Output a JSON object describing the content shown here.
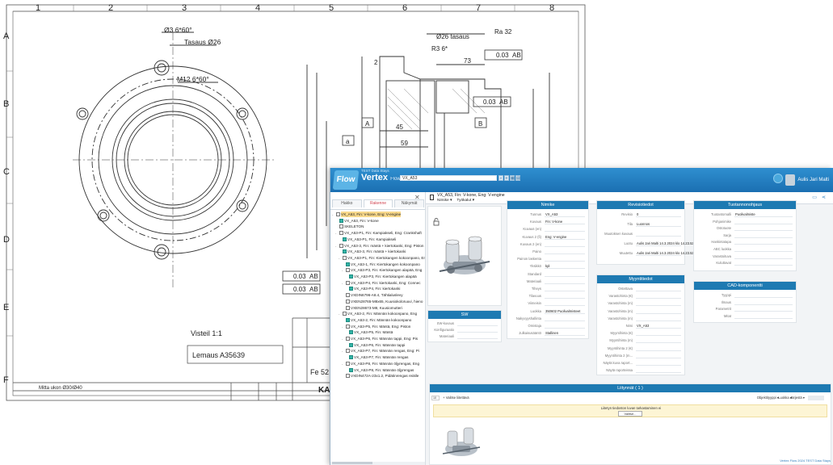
{
  "cad": {
    "columns": [
      "1",
      "2",
      "3",
      "4",
      "5",
      "6",
      "7",
      "8"
    ],
    "rows": [
      "A",
      "B",
      "C",
      "D",
      "E",
      "F"
    ],
    "notes": {
      "hole_spec": "Ø3 6*60°",
      "tasaus": "Tasaus Ø26",
      "thread": "M12 6*60°",
      "dim_tasaus2": "Ø26 tasaus",
      "dim_r3": "R3 6*",
      "dim_73": "73",
      "dim_45": "45",
      "dim_59": "59",
      "dim_2": "2",
      "tol_1": "0.03",
      "tol_a": "AB",
      "tol_2": "0.03",
      "tol_b": "AB",
      "tol_3": "0.03",
      "tol_c": "AB",
      "tol_4": "0.03",
      "tol_d": "AB",
      "roughness": "Ra 32",
      "label_a": "A",
      "label_b": "B",
      "label_a2": "a",
      "visteil": "Visteil 1:1",
      "lemaus": "Lemaus A35639",
      "material": "Fe 52",
      "mitta": "Mitta ukon Ø30/Ø40",
      "ka": "KA"
    }
  },
  "window": {
    "brand_top": "TEST Data Stays",
    "brand": "Vertex",
    "brand_small": "Flow 2024",
    "search_value": "VX_A53",
    "user_name": "Aulis Jari Malti",
    "status_text": "Vertex Flow 2024 TEST Data Stays",
    "status_link": "Vertex Flow 2024 TEST Data Stays"
  },
  "logo": {
    "text": "Flow"
  },
  "left_panel": {
    "tabs": [
      "Hakko",
      "Rakenne",
      "Näkymät"
    ],
    "active_tab": 1,
    "tree": [
      {
        "label": "VX_A53, Fin: V-kone, Eng: V-engine",
        "icon": "doc",
        "level": 0,
        "exp": "-",
        "sel": true
      },
      {
        "label": "VX_A53, Fin: V-kone",
        "icon": "part",
        "level": 1,
        "exp": ""
      },
      {
        "label": "SKELETON",
        "icon": "doc",
        "level": 1,
        "exp": ""
      },
      {
        "label": "VX_A53-P1, Fin: Kampiakseli, Eng: Crankshaft",
        "icon": "doc",
        "level": 1,
        "exp": "-"
      },
      {
        "label": "VX_A53-P1, Fin: Kampiakseli",
        "icon": "part",
        "level": 2,
        "exp": ""
      },
      {
        "label": "VX_A53-3, Fin: mäntä + kiertokanki, Eng: Piston",
        "icon": "doc",
        "level": 1,
        "exp": "-"
      },
      {
        "label": "VX_A53-3, Fin: mäntä + kiertokanki",
        "icon": "part",
        "level": 2,
        "exp": ""
      },
      {
        "label": "VX_A53-P1, Fin: Kiertokangen kokoonpano, Eng",
        "icon": "doc",
        "level": 2,
        "exp": "-"
      },
      {
        "label": "VX_A53-1, Fin: Kiertokangen kokoonpano",
        "icon": "part",
        "level": 3,
        "exp": ""
      },
      {
        "label": "VX_A53-P3, Fin: Kiertokangen alapää, Eng",
        "icon": "doc",
        "level": 3,
        "exp": "-"
      },
      {
        "label": "VX_A53-P3, Fin: Kiertokangen alapää",
        "icon": "part",
        "level": 4,
        "exp": ""
      },
      {
        "label": "VX_A53-P4, Fin: kiertokanki, Eng: Connec",
        "icon": "doc",
        "level": 3,
        "exp": "-"
      },
      {
        "label": "VX_A53-P4, Fin: kiertokanki",
        "icon": "part",
        "level": 4,
        "exp": ""
      },
      {
        "label": "VXDIN6796-A8.4, Tähtialuslevy",
        "icon": "doc",
        "level": 3,
        "exp": ""
      },
      {
        "label": "VXEN28765-M8x65, Kuusiokoloruuvi, hieno",
        "icon": "doc",
        "level": 3,
        "exp": ""
      },
      {
        "label": "VXEN28673-M8, Kuusiomutteri",
        "icon": "doc",
        "level": 3,
        "exp": ""
      },
      {
        "label": "VX_A53-2, Fin: Männän kokoonpano, Eng",
        "icon": "doc",
        "level": 2,
        "exp": "-"
      },
      {
        "label": "VX_A53-2, Fin: Männän kokoonpano",
        "icon": "part",
        "level": 3,
        "exp": ""
      },
      {
        "label": "VX_A53-P5, Fin: Mäntä, Eng: Piston",
        "icon": "doc",
        "level": 3,
        "exp": "-"
      },
      {
        "label": "VX_A53-P5, Fin: Mäntä",
        "icon": "part",
        "level": 4,
        "exp": ""
      },
      {
        "label": "VX_A53-P6, Fin: Männän tappi, Eng: Pis",
        "icon": "doc",
        "level": 3,
        "exp": "-"
      },
      {
        "label": "VX_A53-P6, Fin: Männän tappi",
        "icon": "part",
        "level": 4,
        "exp": ""
      },
      {
        "label": "VX_A53-P7, Fin: Männän rengas, Eng: Pi",
        "icon": "doc",
        "level": 3,
        "exp": "-"
      },
      {
        "label": "VX_A53-P7, Fin: Männän rengas",
        "icon": "part",
        "level": 4,
        "exp": ""
      },
      {
        "label": "VX_A53-P8, Fin: Männän öljyrengas, Eng",
        "icon": "doc",
        "level": 3,
        "exp": "-"
      },
      {
        "label": "VX_A53-P8, Fin: Männän öljyrengas",
        "icon": "part",
        "level": 4,
        "exp": ""
      },
      {
        "label": "VXDIN472A-23x1.2, Pidätinrengas reiälle",
        "icon": "doc",
        "level": 3,
        "exp": ""
      }
    ]
  },
  "header": {
    "title": "VX_A53, Fin: V-kone, Eng: V-engine",
    "menu": [
      "Nimike ▾",
      "Työkalut ▾"
    ]
  },
  "nimike": {
    "title": "Nimike",
    "fields": [
      {
        "label": "Tunnus",
        "value": "VX_A53"
      },
      {
        "label": "Kuvaus",
        "value": "Fin: V-kone"
      },
      {
        "label": "Kuvaus (en)",
        "value": ""
      },
      {
        "label": "Kuvaus 2 (fi)",
        "value": "Eng: V-engine"
      },
      {
        "label": "Kuvaus 2 (en)",
        "value": ""
      },
      {
        "label": "Paino",
        "value": ""
      },
      {
        "label": "Painon laskenta",
        "value": ""
      },
      {
        "label": "Yksikkö",
        "value": "kpl"
      },
      {
        "label": "Standard",
        "value": ""
      },
      {
        "label": "Materiaali",
        "value": ""
      },
      {
        "label": "Tiheys",
        "value": ""
      },
      {
        "label": "Tilavuus",
        "value": ""
      },
      {
        "label": "Viimeisin",
        "value": ""
      },
      {
        "label": "Luokka",
        "value": "350602 Puolivalmisteet"
      },
      {
        "label": "Nakyvyyshallinta",
        "value": ""
      },
      {
        "label": "Omistaja",
        "value": ""
      },
      {
        "label": "Julkaisusääntö",
        "value": "Stallinen"
      }
    ]
  },
  "revisio": {
    "title": "Revisiotiedot",
    "fields": [
      {
        "label": "Revisio",
        "value": "0"
      },
      {
        "label": "Tila",
        "value": "Luonnos"
      },
      {
        "label": "Muutoksen kuvaus",
        "value": ""
      },
      {
        "label": "Luotu",
        "value": "Aulis Jari Malti 14.3.2024 klo 14.23.53"
      },
      {
        "label": "Muutettu",
        "value": "Aulis Jari Malti 14.3.2024 klo 14.23.53"
      }
    ]
  },
  "myynti": {
    "title": "Myyntitiedot",
    "fields": [
      {
        "label": "Ostettava",
        "value": ""
      },
      {
        "label": "Varastohinta (€)",
        "value": ""
      },
      {
        "label": "Varastohinta (m)",
        "value": ""
      },
      {
        "label": "Varastohinta (m)",
        "value": ""
      },
      {
        "label": "Varastohinta (m)",
        "value": ""
      },
      {
        "label": "Nimi",
        "value": "VX_A53"
      },
      {
        "label": "Myyntihinta (€)",
        "value": ""
      },
      {
        "label": "Myyntihinta (m)",
        "value": ""
      },
      {
        "label": "Myyntihinta 2 (€)",
        "value": ""
      },
      {
        "label": "Myyntihinta 2 (m...",
        "value": ""
      },
      {
        "label": "Näytä kuva raport...",
        "value": ""
      },
      {
        "label": "Näytä raporteissa",
        "value": ""
      }
    ]
  },
  "tuotanto": {
    "title": "Tuotannonohjaus",
    "fields": [
      {
        "label": "Tuotantomalli",
        "value": "Puolivalmiste"
      },
      {
        "label": "Pohjanimike",
        "value": ""
      },
      {
        "label": "Ostotuote",
        "value": ""
      },
      {
        "label": "Sarja",
        "value": ""
      },
      {
        "label": "Hankintatapa",
        "value": ""
      },
      {
        "label": "ABC luokka",
        "value": ""
      },
      {
        "label": "Varastoituva",
        "value": ""
      },
      {
        "label": "Kuluttavat",
        "value": ""
      }
    ]
  },
  "cad_comp": {
    "title": "CAD-komponentti",
    "fields": [
      {
        "label": "Tyyppi",
        "value": ""
      },
      {
        "label": "Ilmaus",
        "value": ""
      },
      {
        "label": "Parametrit",
        "value": ""
      },
      {
        "label": "Mitat",
        "value": ""
      }
    ]
  },
  "sw": {
    "title": "SW",
    "fields": [
      {
        "label": "SW-kuvaus",
        "value": ""
      },
      {
        "label": "Konfiguraatio",
        "value": ""
      },
      {
        "label": "Materiaali",
        "value": ""
      }
    ]
  },
  "liitteet": {
    "title": "Liitynnät ( 1 )",
    "page_size": "10",
    "add_label": "+ Valitse liitettävä",
    "toolbar": [
      "Objektityyppi ▾",
      "Luokka ▾",
      "Järjestä ▾"
    ],
    "warning": "Liitetyn tiedoston luvan tarkastaminen ei",
    "warning_btn": "Valitse..."
  }
}
